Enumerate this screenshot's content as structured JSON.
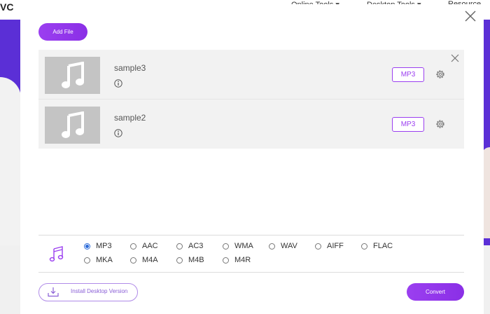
{
  "background": {
    "logo": "VC",
    "nav": [
      "Online Tools",
      "Desktop Tools",
      "Resource"
    ]
  },
  "toolbar": {
    "add_file_label": "Add File"
  },
  "files": [
    {
      "name": "sample3",
      "format": "MP3"
    },
    {
      "name": "sample2",
      "format": "MP3"
    }
  ],
  "formats": {
    "row1": [
      "MP3",
      "AAC",
      "AC3",
      "WMA",
      "WAV",
      "AIFF",
      "FLAC"
    ],
    "row2": [
      "MKA",
      "M4A",
      "M4B",
      "M4R"
    ],
    "selected": "MP3"
  },
  "footer": {
    "install_label": "Install Desktop Version",
    "convert_label": "Convert"
  },
  "colors": {
    "accent": "#9b3ff0",
    "hero": "#5b2fd6",
    "radio_selected": "#2a6ad8"
  },
  "icons": {
    "music": "music-note-icon",
    "info": "info-icon",
    "settings": "gear-icon",
    "close": "close-icon",
    "download": "download-icon"
  }
}
